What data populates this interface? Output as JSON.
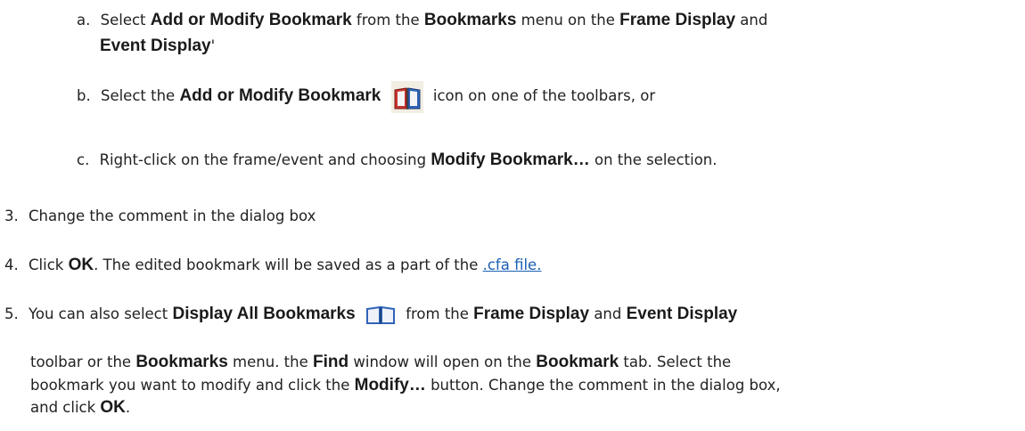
{
  "items": {
    "a": {
      "marker": "a.",
      "t1": "Select ",
      "b1": "Add or Modify Bookmark",
      "t2": " from the ",
      "b2": "Bookmarks",
      "t3": " menu on the ",
      "b3": "Frame Display",
      "t4": " and",
      "b4": "Event Display",
      "t5": "'"
    },
    "b": {
      "marker": "b.",
      "t1": "Select the ",
      "b1": "Add or Modify Bookmark",
      "icon": "add-modify-bookmark-icon",
      "t2": " icon on one of the toolbars, or"
    },
    "c": {
      "marker": "c.",
      "t1": "Right-click on the frame/event and choosing ",
      "b1": "Modify Bookmark…",
      "t2": " on the selection."
    },
    "s3": {
      "marker": "3.",
      "text": "Change the comment in the dialog box"
    },
    "s4": {
      "marker": "4.",
      "t1": "Click ",
      "b1": "OK",
      "t2": ". The edited bookmark will be saved as a part of the ",
      "link": ".cfa file."
    },
    "s5": {
      "marker": "5.",
      "t1": "You can also select ",
      "b1": "Display All Bookmarks",
      "icon": "display-all-bookmarks-icon",
      "t2": " from the ",
      "b2": "Frame Display",
      "t3": " and ",
      "b3": "Event Display",
      "p2_t1": "toolbar or the ",
      "p2_b1": "Bookmarks",
      "p2_t2": " menu. the ",
      "p2_b2": "Find",
      "p2_t3": " window will open on the ",
      "p2_b3": "Bookmark",
      "p2_t4": " tab. Select the",
      "p3_t1": "bookmark you want to modify and click the ",
      "p3_b1": "Modify…",
      "p3_t2": " button. Change the comment in the dialog box,",
      "p4_t1": "and click ",
      "p4_b1": "OK",
      "p4_t2": "."
    }
  },
  "colors": {
    "text": "#222222",
    "link": "#1a5fb4",
    "book_red": "#c8322b",
    "book_blue": "#2f63b8"
  }
}
